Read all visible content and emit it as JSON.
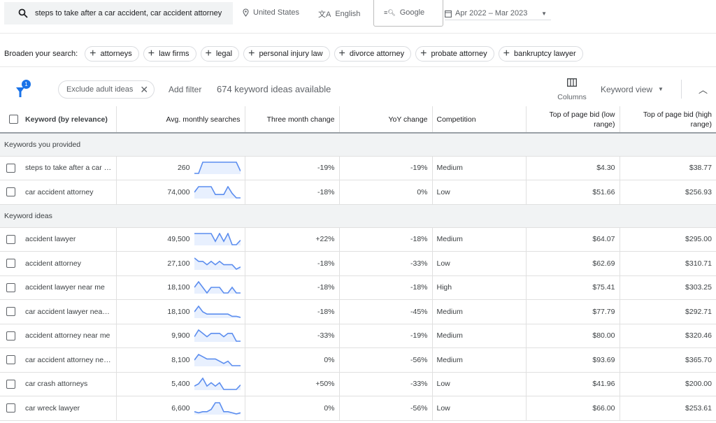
{
  "topbar": {
    "search_query": "steps to take after a car accident, car accident attorney",
    "location": "United States",
    "language": "English",
    "network": "Google",
    "date_range": "Apr 2022 – Mar 2023"
  },
  "broaden": {
    "label": "Broaden your search:",
    "chips": [
      "attorneys",
      "law firms",
      "legal",
      "personal injury law",
      "divorce attorney",
      "probate attorney",
      "bankruptcy lawyer"
    ]
  },
  "filters": {
    "badge": "1",
    "exclude_chip": "Exclude adult ideas",
    "add_filter": "Add filter",
    "count_text": "674 keyword ideas available",
    "columns": "Columns",
    "view": "Keyword view"
  },
  "colors": {
    "accent": "#1a73e8",
    "spark_line": "#5b8def",
    "spark_fill": "#e8f0fe"
  },
  "table": {
    "headers": [
      "Keyword (by relevance)",
      "Avg. monthly searches",
      "Three month change",
      "YoY change",
      "Competition",
      "Top of page bid (low range)",
      "Top of page bid (high range)"
    ],
    "groups": [
      {
        "label": "Keywords you provided",
        "rows": [
          {
            "keyword": "steps to take after a car …",
            "avg": "260",
            "trend": [
              0,
              0,
              10,
              10,
              10,
              10,
              10,
              10,
              10,
              10,
              10,
              2
            ],
            "three": "-19%",
            "yoy": "-19%",
            "comp": "Medium",
            "low": "$4.30",
            "high": "$38.77"
          },
          {
            "keyword": "car accident attorney",
            "avg": "74,000",
            "trend": [
              5,
              10,
              10,
              10,
              10,
              3,
              3,
              3,
              10,
              4,
              0,
              0
            ],
            "three": "-18%",
            "yoy": "0%",
            "comp": "Low",
            "low": "$51.66",
            "high": "$256.93"
          }
        ]
      },
      {
        "label": "Keyword ideas",
        "rows": [
          {
            "keyword": "accident lawyer",
            "avg": "49,500",
            "trend": [
              10,
              10,
              10,
              10,
              10,
              3,
              10,
              3,
              10,
              0,
              0,
              4
            ],
            "three": "+22%",
            "yoy": "-18%",
            "comp": "Medium",
            "low": "$64.07",
            "high": "$295.00"
          },
          {
            "keyword": "accident attorney",
            "avg": "27,100",
            "trend": [
              10,
              7,
              7,
              4,
              7,
              4,
              7,
              4,
              4,
              4,
              0,
              2
            ],
            "three": "-18%",
            "yoy": "-33%",
            "comp": "Low",
            "low": "$62.69",
            "high": "$310.71"
          },
          {
            "keyword": "accident lawyer near me",
            "avg": "18,100",
            "trend": [
              5,
              10,
              5,
              0,
              5,
              5,
              5,
              0,
              0,
              5,
              0,
              0
            ],
            "three": "-18%",
            "yoy": "-18%",
            "comp": "High",
            "low": "$75.41",
            "high": "$303.25"
          },
          {
            "keyword": "car accident lawyer near …",
            "avg": "18,100",
            "trend": [
              5,
              10,
              5,
              3,
              3,
              3,
              3,
              3,
              3,
              1,
              1,
              0
            ],
            "three": "-18%",
            "yoy": "-45%",
            "comp": "Medium",
            "low": "$77.79",
            "high": "$292.71"
          },
          {
            "keyword": "accident attorney near me",
            "avg": "9,900",
            "trend": [
              4,
              10,
              7,
              4,
              7,
              7,
              7,
              4,
              7,
              7,
              0,
              0
            ],
            "three": "-33%",
            "yoy": "-19%",
            "comp": "Medium",
            "low": "$80.00",
            "high": "$320.46"
          },
          {
            "keyword": "car accident attorney ne…",
            "avg": "8,100",
            "trend": [
              5,
              10,
              8,
              6,
              6,
              6,
              4,
              2,
              4,
              0,
              0,
              0
            ],
            "three": "0%",
            "yoy": "-56%",
            "comp": "Medium",
            "low": "$93.69",
            "high": "$365.70"
          },
          {
            "keyword": "car crash attorneys",
            "avg": "5,400",
            "trend": [
              3,
              5,
              10,
              3,
              6,
              3,
              6,
              0,
              0,
              0,
              0,
              4
            ],
            "three": "+50%",
            "yoy": "-33%",
            "comp": "Low",
            "low": "$41.96",
            "high": "$200.00"
          },
          {
            "keyword": "car wreck lawyer",
            "avg": "6,600",
            "trend": [
              2,
              1,
              2,
              2,
              4,
              10,
              10,
              2,
              2,
              1,
              0,
              1
            ],
            "three": "0%",
            "yoy": "-56%",
            "comp": "Low",
            "low": "$66.00",
            "high": "$253.61"
          }
        ]
      }
    ]
  }
}
